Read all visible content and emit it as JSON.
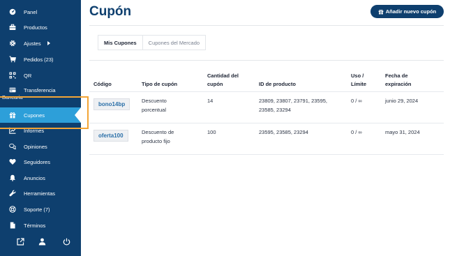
{
  "sidebar": {
    "items": [
      {
        "label": "Panel",
        "icon": "dashboard-icon"
      },
      {
        "label": "Productos",
        "icon": "briefcase-icon"
      },
      {
        "label": "Ajustes",
        "icon": "gear-icon"
      },
      {
        "label": "Pedidos (23)",
        "icon": "cart-icon"
      },
      {
        "label": "QR",
        "icon": "qr-icon"
      },
      {
        "label": "Transferencia",
        "label2": "Bancaria",
        "icon": "bank-transfer-icon"
      },
      {
        "label": "Cupones",
        "icon": "gift-icon"
      },
      {
        "label": "Informes",
        "icon": "chart-icon"
      },
      {
        "label": "Opiniones",
        "icon": "chat-icon"
      },
      {
        "label": "Seguidores",
        "icon": "heart-icon"
      },
      {
        "label": "Anuncios",
        "icon": "bell-icon"
      },
      {
        "label": "Herramientas",
        "icon": "wrench-icon"
      },
      {
        "label": "Soporte (7)",
        "icon": "support-icon"
      },
      {
        "label": "Términos",
        "icon": "document-icon"
      }
    ],
    "active": "Cupones",
    "bottom_icons": [
      "external-link-icon",
      "user-icon",
      "power-icon"
    ]
  },
  "header": {
    "title": "Cupón",
    "add_button": "Añadir nuevo cupón"
  },
  "tabs": [
    "Mis Cupones",
    "Cupones del Mercado"
  ],
  "table": {
    "headers": {
      "code": "Código",
      "type": "Tipo de cupón",
      "amount_1": "Cantidad del",
      "amount_2": "cupón",
      "product": "ID de producto",
      "usage_1": "Uso /",
      "usage_2": "Límite",
      "expiry_1": "Fecha de",
      "expiry_2": "expiración"
    },
    "rows": [
      {
        "code": "bono14bp",
        "type_1": "Descuento",
        "type_2": "porcentual",
        "amount": "14",
        "product_1": "23809, 23807, 23791, 23595,",
        "product_2": "23585, 23294",
        "usage": "0 / ∞",
        "expiry": "junio 29, 2024"
      },
      {
        "code": "oferta100",
        "type_1": "Descuento de",
        "type_2": "producto fijo",
        "amount": "100",
        "product_1": "23595, 23585, 23294",
        "product_2": "",
        "usage": "0 / ∞",
        "expiry": "mayo 31, 2024"
      }
    ]
  },
  "colors": {
    "sidebar_bg": "#0e3f6e",
    "active_item": "#2d9fd9",
    "highlight": "#f3a536",
    "code_text": "#2a6fa8"
  }
}
